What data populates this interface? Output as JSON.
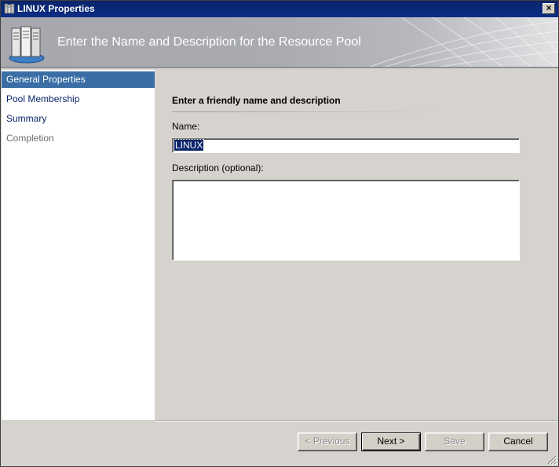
{
  "window": {
    "title": "LINUX Properties",
    "close_glyph": "×"
  },
  "banner": {
    "heading": "Enter the Name and Description for the Resource Pool",
    "icon": "server-pool-icon"
  },
  "nav": {
    "items": [
      {
        "label": "General Properties",
        "state": "active"
      },
      {
        "label": "Pool Membership",
        "state": "enabled"
      },
      {
        "label": "Summary",
        "state": "enabled"
      },
      {
        "label": "Completion",
        "state": "disabled"
      }
    ]
  },
  "form": {
    "section_title": "Enter a friendly name and description",
    "name_label": "Name:",
    "name_value": "LINUX",
    "description_label": "Description (optional):",
    "description_value": ""
  },
  "buttons": {
    "previous": "< Previous",
    "next": "Next >",
    "save": "Save",
    "cancel": "Cancel"
  },
  "colors": {
    "titlebar": "#0a246a",
    "nav_selected": "#3a6ea5",
    "nav_link": "#0a246a"
  }
}
